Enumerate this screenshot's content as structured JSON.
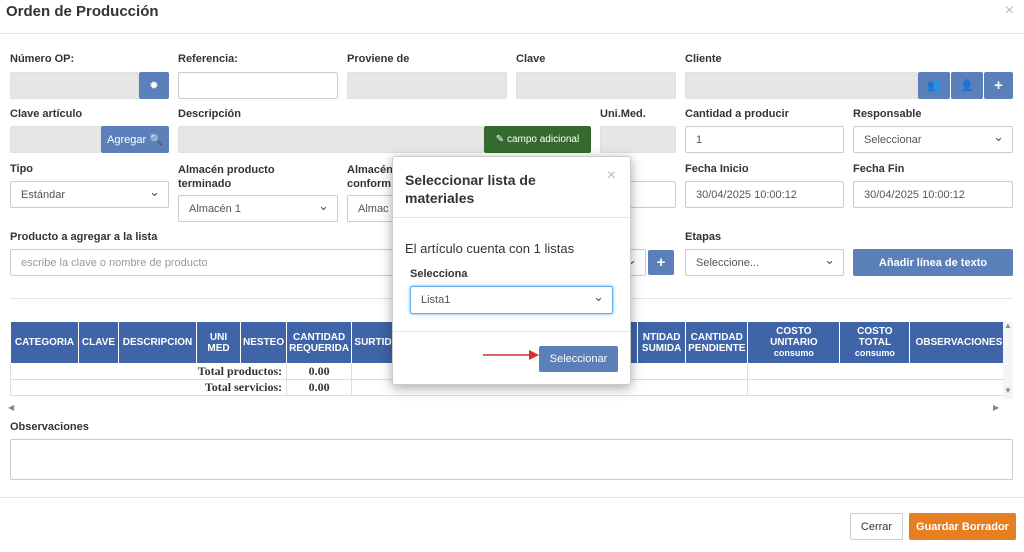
{
  "header": {
    "title": "Orden de Producción",
    "close": "×"
  },
  "row1": {
    "numero_op_label": "Número OP:",
    "referencia_label": "Referencia:",
    "proviene_label": "Proviene de",
    "clave_label": "Clave",
    "cliente_label": "Cliente"
  },
  "row2": {
    "clave_articulo_label": "Clave artículo",
    "agregar_label": "Agregar",
    "descripcion_label": "Descripción",
    "campo_adicional_label": "campo adicional",
    "unimed_label": "Uni.Med.",
    "cantidad_label": "Cantidad a producir",
    "cantidad_value": "1",
    "responsable_label": "Responsable",
    "responsable_value": "Seleccionar"
  },
  "row3": {
    "tipo_label": "Tipo",
    "tipo_value": "Estándar",
    "almacen_pt_label_1": "Almacén producto",
    "almacen_pt_label_2": "terminado",
    "almacen_pt_value": "Almacén 1",
    "almacen_nc_label_1": "Almacén",
    "almacen_nc_label_2": "conform",
    "almacen_nc_value": "Almac",
    "fecha_inicio_label": "Fecha Inicio",
    "fecha_inicio_value": "30/04/2025 10:00:12",
    "fecha_fin_label": "Fecha Fin",
    "fecha_fin_value": "30/04/2025 10:00:12"
  },
  "row4": {
    "producto_label": "Producto a agregar a la lista",
    "producto_placeholder": "escribe la clave o nombre de producto",
    "etapas_label": "Etapas",
    "etapas_value": "Seleccione...",
    "anadir_label": "Añadir línea de texto"
  },
  "table": {
    "headers": [
      "CATEGORIA",
      "CLAVE",
      "DESCRIPCION",
      "UNI MED",
      "NESTEO",
      "CANTIDAD REQUERIDA",
      "SURTIDA",
      "CANTIDAD CONSUMIDA",
      "CANTIDAD PENDIENTE",
      "COSTO UNITARIO consumo",
      "COSTO TOTAL consumo",
      "OBSERVACIONES"
    ],
    "h_uni_1": "UNI",
    "h_uni_2": "MED",
    "h_creq_1": "CANTIDAD",
    "h_creq_2": "REQUERIDA",
    "h_ccons_1": "NTIDAD",
    "h_ccons_2": "SUMIDA",
    "h_cpend_1": "CANTIDAD",
    "h_cpend_2": "PENDIENTE",
    "h_cu_1": "COSTO",
    "h_cu_2": "UNITARIO",
    "h_cu_3": "consumo",
    "h_ct_1": "COSTO",
    "h_ct_2": "TOTAL",
    "h_ct_3": "consumo",
    "total_productos_label": "Total productos:",
    "total_productos_value": "0.00",
    "total_servicios_label": "Total servicios:",
    "total_servicios_value": "0.00"
  },
  "observaciones_label": "Observaciones",
  "footer": {
    "cerrar": "Cerrar",
    "guardar": "Guardar Borrador"
  },
  "modal": {
    "title_1": "Seleccionar lista de",
    "title_2": "materiales",
    "close": "×",
    "message": "El artículo cuenta con 1 listas",
    "selecciona_label": "Selecciona",
    "select_value": "Lista1",
    "seleccionar_button": "Seleccionar"
  },
  "colors": {
    "primary": "#5b7fb8",
    "header_blue": "#3f64a8",
    "green": "#356a2e",
    "orange": "#e67e22",
    "arrow": "#d32f2f"
  }
}
